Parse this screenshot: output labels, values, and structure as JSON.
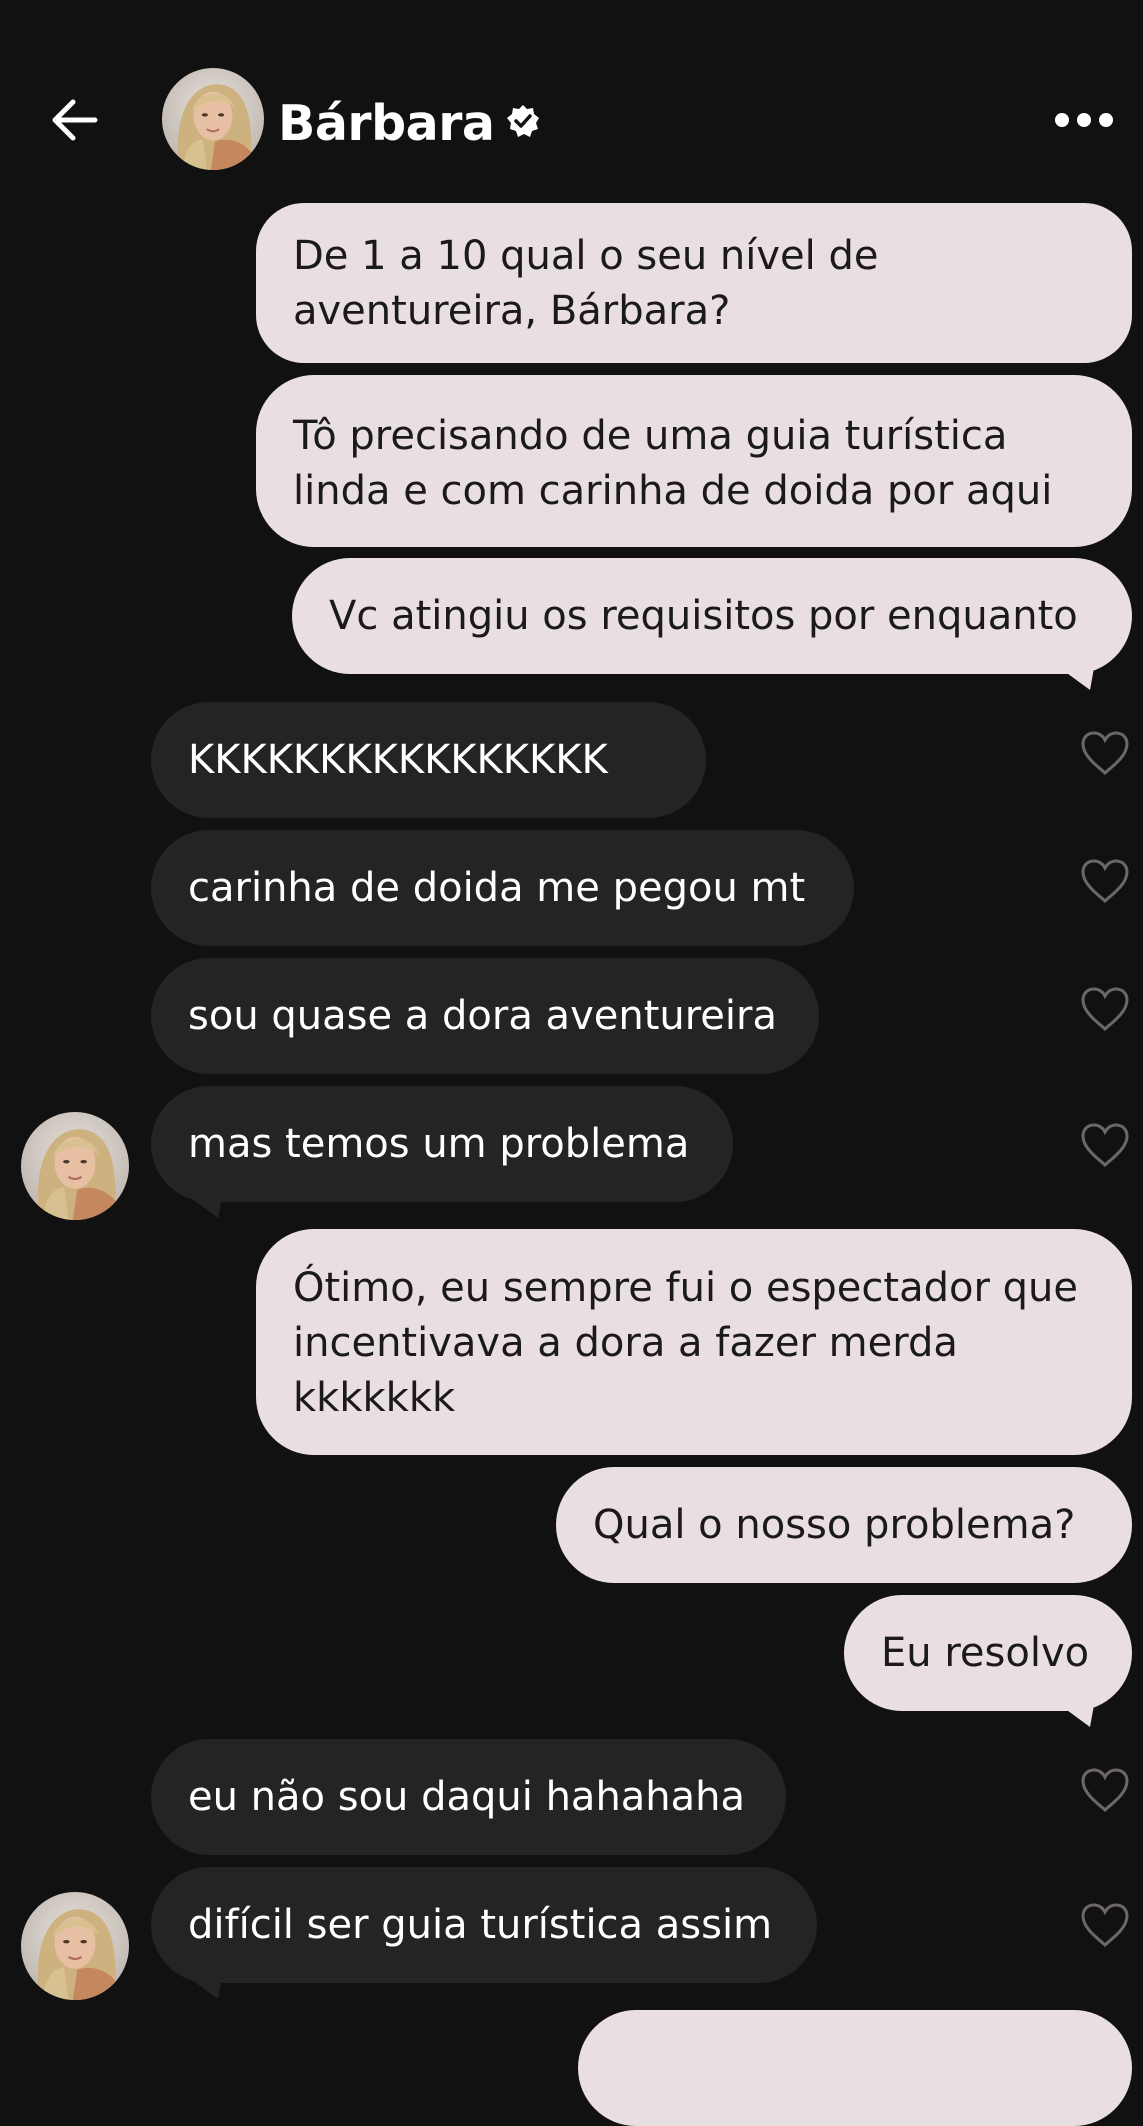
{
  "header": {
    "contact_name": "Bárbara",
    "back_icon": "arrow-left-icon",
    "verified_icon": "verified-badge-icon",
    "more_icon": "more-horizontal-icon"
  },
  "colors": {
    "background": "#121111",
    "sent_bubble": "#e9dfe0",
    "sent_text": "#1b1a1a",
    "received_bubble": "#262323",
    "received_text": "#ffffff",
    "heart_outline": "#6d6767"
  },
  "messages": [
    {
      "direction": "sent",
      "text": "De 1 a 10 qual o seu nível de aventureira, Bárbara?"
    },
    {
      "direction": "sent",
      "text": "Tô precisando de uma guia turística linda e com carinha de doida por aqui"
    },
    {
      "direction": "sent",
      "text": "Vc atingiu os requisitos por enquanto"
    },
    {
      "direction": "received",
      "text": "KKKKKKKKKKKKKKKK"
    },
    {
      "direction": "received",
      "text": "carinha de doida me pegou mt"
    },
    {
      "direction": "received",
      "text": "sou quase a dora aventureira"
    },
    {
      "direction": "received",
      "text": "mas temos um problema"
    },
    {
      "direction": "sent",
      "text": "Ótimo, eu sempre fui o espectador que incentivava a dora a fazer merda kkkkkkk"
    },
    {
      "direction": "sent",
      "text": "Qual o nosso problema?"
    },
    {
      "direction": "sent",
      "text": "Eu resolvo"
    },
    {
      "direction": "received",
      "text": "eu não sou daqui hahahaha"
    },
    {
      "direction": "received",
      "text": "difícil ser guia turística assim"
    }
  ]
}
